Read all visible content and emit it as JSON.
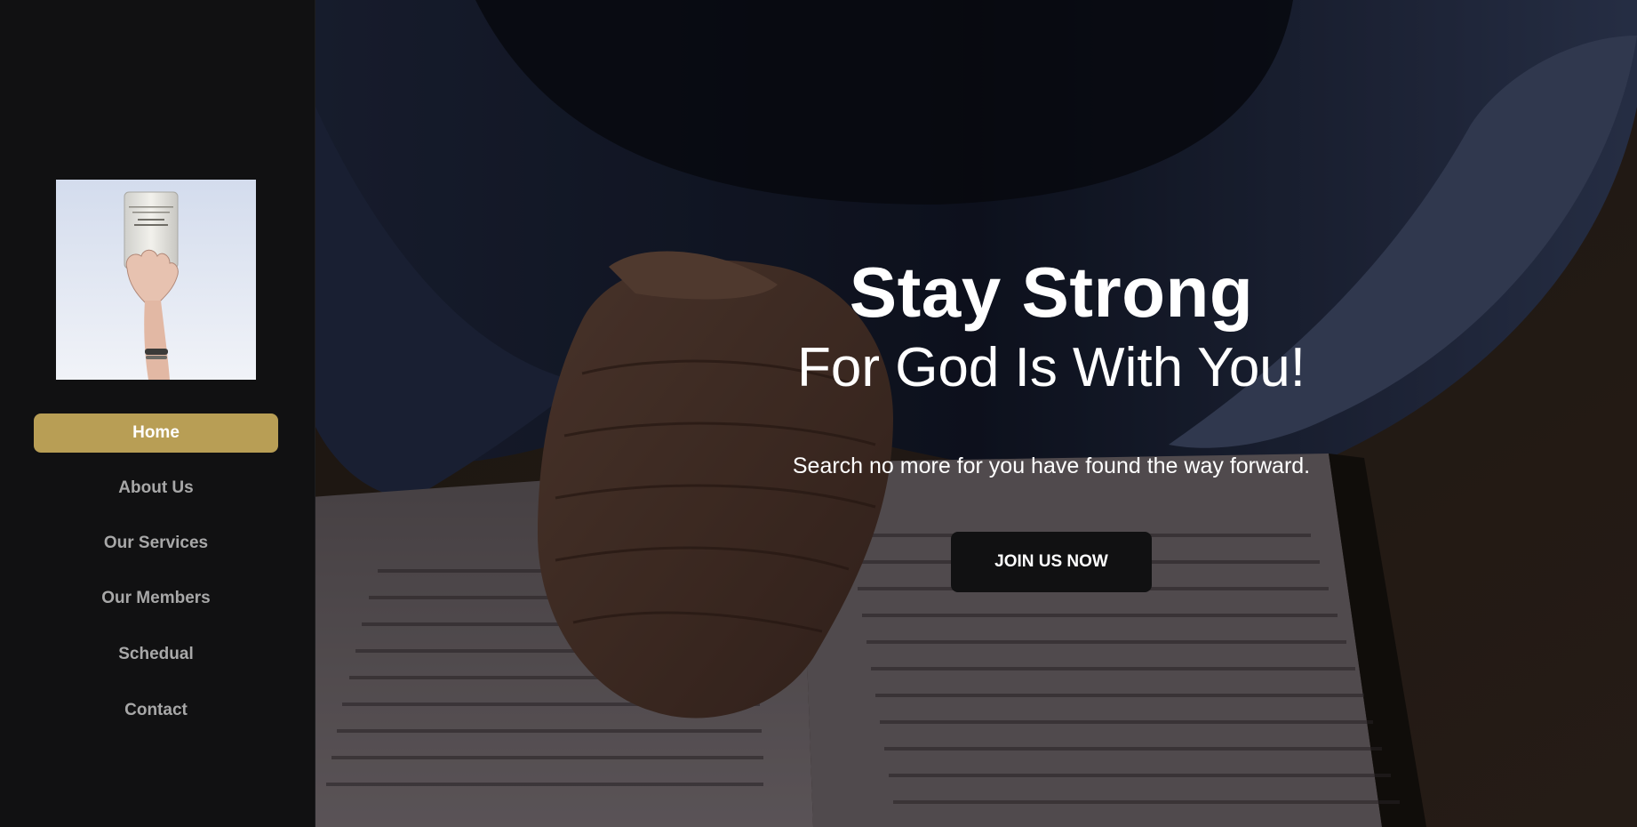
{
  "sidebar": {
    "logo_icon": "hand-holding-bible-image",
    "nav": [
      {
        "label": "Home",
        "active": true
      },
      {
        "label": "About Us",
        "active": false
      },
      {
        "label": "Our Services",
        "active": false
      },
      {
        "label": "Our Members",
        "active": false
      },
      {
        "label": "Schedual",
        "active": false
      },
      {
        "label": "Contact",
        "active": false
      }
    ]
  },
  "hero": {
    "title": "Stay Strong",
    "subtitle": "For God Is With You!",
    "text": "Search no more for you have found the way forward.",
    "cta_label": "JOIN US NOW",
    "background_icon": "praying-hands-on-bible-image"
  },
  "colors": {
    "sidebar_bg": "#111112",
    "accent": "#b89e55",
    "button_bg": "#111112",
    "text_light": "#ffffff",
    "nav_text": "#a8a8a8"
  }
}
